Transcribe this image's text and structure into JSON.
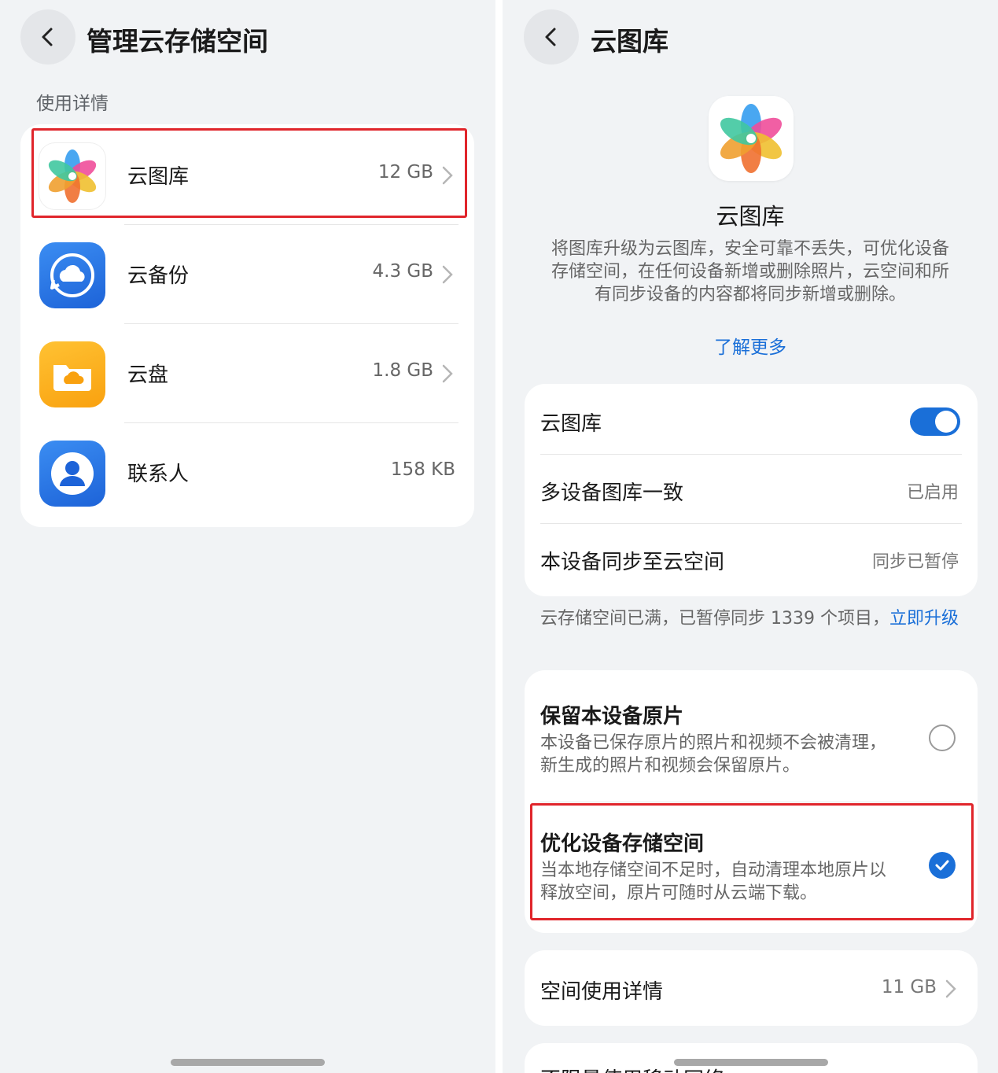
{
  "left": {
    "title": "管理云存储空间",
    "section_label": "使用详情",
    "items": [
      {
        "name": "云图库",
        "size": "12 GB",
        "icon": "cloud-gallery-icon"
      },
      {
        "name": "云备份",
        "size": "4.3 GB",
        "icon": "cloud-backup-icon"
      },
      {
        "name": "云盘",
        "size": "1.8 GB",
        "icon": "cloud-drive-icon"
      },
      {
        "name": "联系人",
        "size": "158 KB",
        "icon": "contacts-icon"
      }
    ]
  },
  "right": {
    "title": "云图库",
    "app_name": "云图库",
    "description": "将图库升级为云图库，安全可靠不丢失，可优化设备存储空间，在任何设备新增或删除照片，云空间和所有同步设备的内容都将同步新增或删除。",
    "learn_more": "了解更多",
    "settings": {
      "toggle_label": "云图库",
      "toggle_on": true,
      "multi_device_label": "多设备图库一致",
      "multi_device_value": "已启用",
      "sync_label": "本设备同步至云空间",
      "sync_value": "同步已暂停"
    },
    "notice_text": "云存储空间已满，已暂停同步 1339 个项目，",
    "notice_link": "立即升级",
    "options": [
      {
        "title": "保留本设备原片",
        "desc": "本设备已保存原片的照片和视频不会被清理，新生成的照片和视频会保留原片。",
        "checked": false
      },
      {
        "title": "优化设备存储空间",
        "desc": "当本地存储空间不足时，自动清理本地原片以释放空间，原片可随时从云端下载。",
        "checked": true
      }
    ],
    "usage_label": "空间使用详情",
    "usage_value": "11 GB",
    "peek_label": "不限量使用移动网络"
  },
  "colors": {
    "accent": "#1a6fd8",
    "highlight": "#e0252b",
    "background": "#f1f3f5"
  }
}
